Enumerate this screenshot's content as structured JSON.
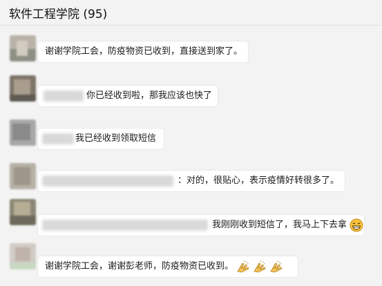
{
  "header": {
    "title": "软件工程学院 (95)"
  },
  "messages": [
    {
      "text": "谢谢学院工会，防疫物资已收到，直接送到家了。"
    },
    {
      "text": "你已经收到啦，那我应该也快了"
    },
    {
      "text": "我已经收到领取短信"
    },
    {
      "text": "：对的，很贴心，表示疫情好转很多了。"
    },
    {
      "text": "我刚刚收到短信了，我马上下去拿",
      "emoji": "grin-icon"
    },
    {
      "text": "谢谢学院工会，谢谢彭老师，防疫物资已收到。",
      "emoji": "clapping-hands-icon"
    }
  ],
  "colors": {
    "background": "#f3f3f3",
    "bubble": "#ffffff",
    "text": "#1a1a1a"
  }
}
